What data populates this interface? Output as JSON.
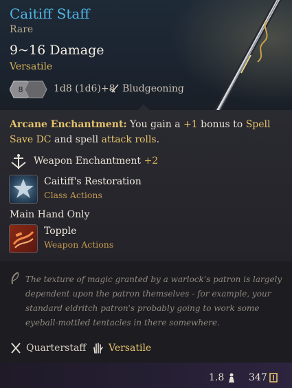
{
  "item": {
    "name": "Caitiff Staff",
    "rarity": "Rare",
    "damage": "9~16 Damage",
    "property": "Versatile",
    "damage_die": "8",
    "damage_formula": "1d8 (1d6)+8",
    "damage_type": "Bludgeoning"
  },
  "enchantment": {
    "label": "Arcane Enchantment:",
    "text_1": " You gain a ",
    "bonus": "+1",
    "text_2": " bonus to ",
    "spell_save": "Spell Save DC",
    "text_3": " and spell ",
    "attack_rolls": "attack rolls",
    "text_4": "."
  },
  "weapon_enchantment": {
    "label": "Weapon Enchantment",
    "value": "+2"
  },
  "actions": [
    {
      "name": "Caitiff's Restoration",
      "category": "Class Actions"
    },
    {
      "name": "Topple",
      "category": "Weapon Actions"
    }
  ],
  "main_hand_label": "Main Hand Only",
  "lore": "The texture of magic granted by a warlock's patron is largely dependent upon the patron themselves - for example, your standard eldritch patron's probably going to work some eyeball-mottled tentacles in there somewhere.",
  "tags": [
    {
      "label": "Quarterstaff"
    },
    {
      "label": "Versatile"
    }
  ],
  "footer": {
    "weight": "1.8",
    "value": "347"
  },
  "colors": {
    "title": "#4fb6e6",
    "highlight": "#e6c46b",
    "action_category": "#c49a52",
    "lore": "#8d877c"
  },
  "icons": {
    "damage_type": "sword-icon",
    "weapon_enchantment": "enchantment-icon",
    "lore": "quill-icon",
    "quarterstaff": "crossed-staves-icon",
    "versatile": "hand-icon",
    "weight": "weight-icon",
    "value": "gold-coin-icon"
  }
}
